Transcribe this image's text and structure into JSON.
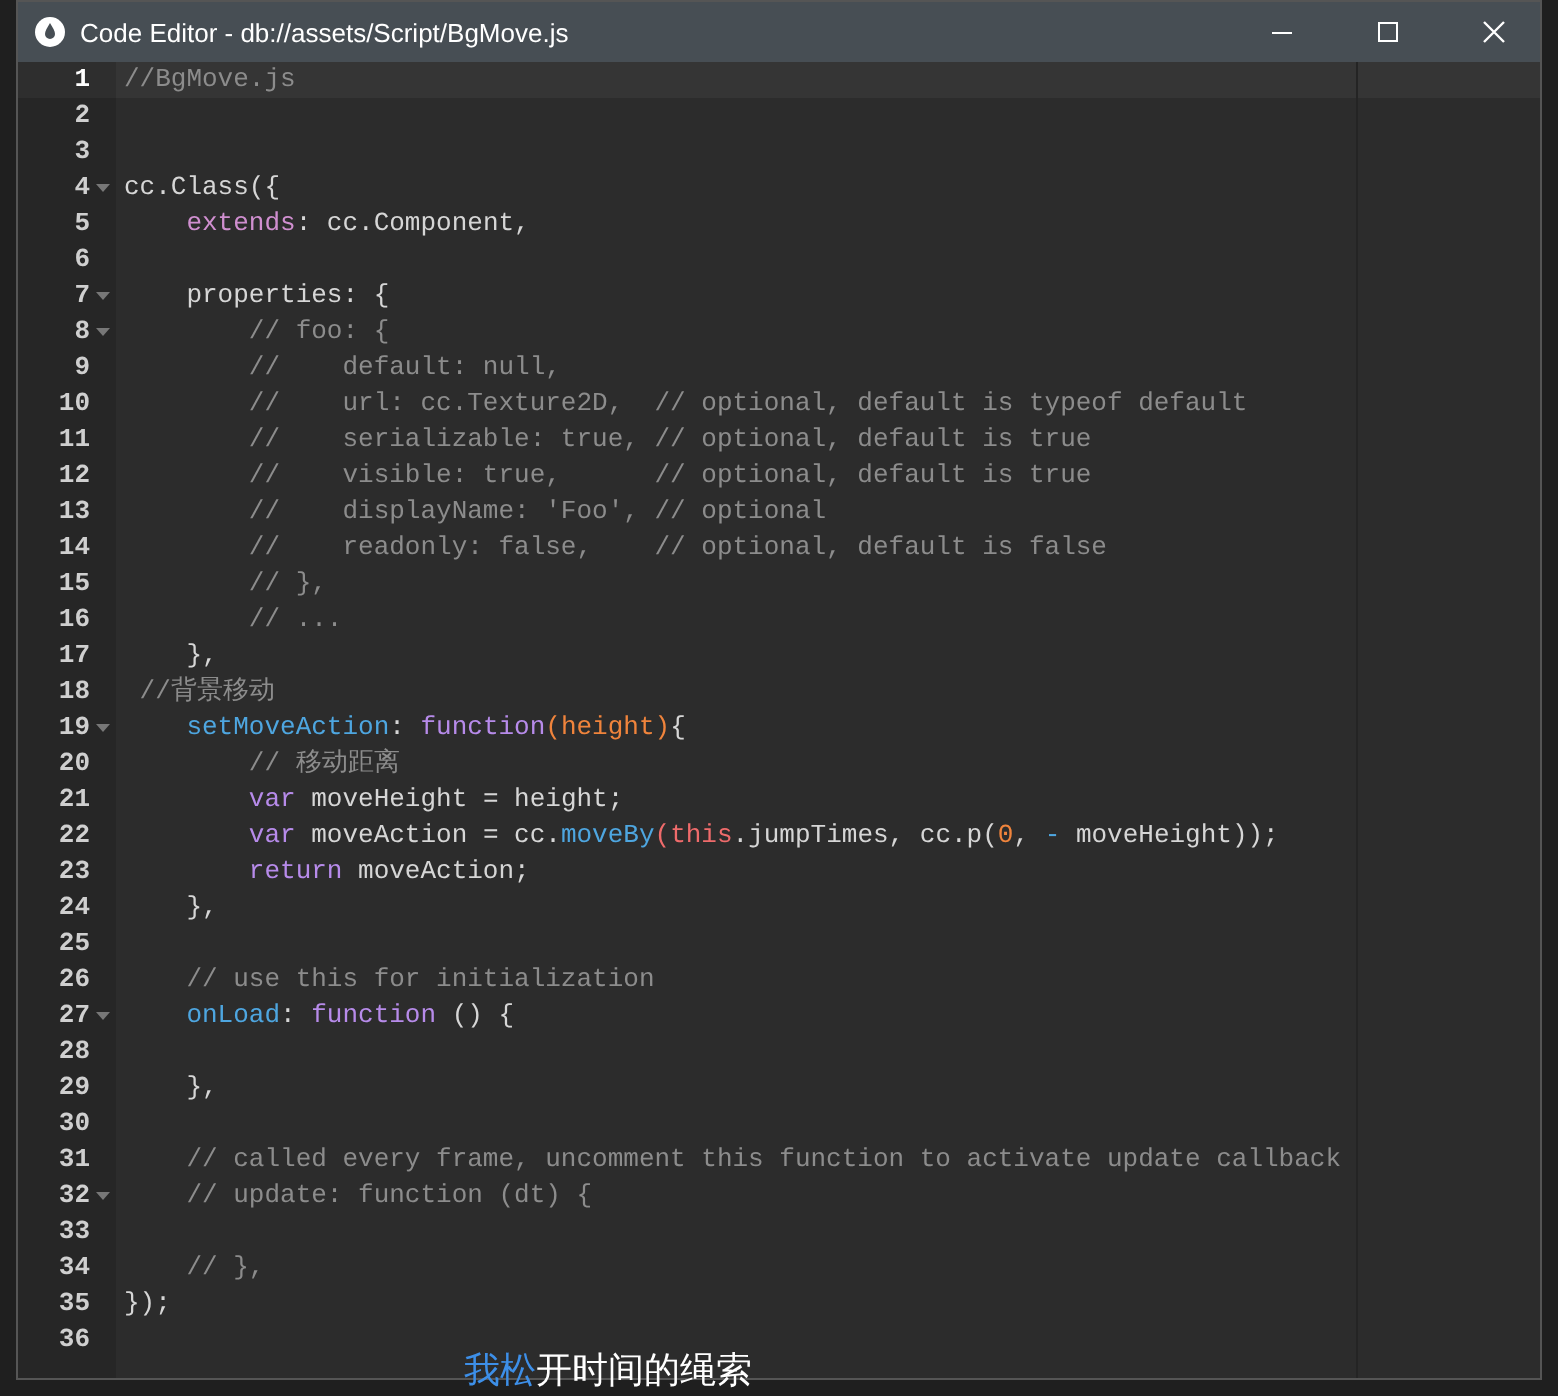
{
  "window": {
    "title": "Code Editor - db://assets/Script/BgMove.js"
  },
  "lines": [
    {
      "number": "1",
      "current": true,
      "fold": false,
      "tokens": [
        {
          "kind": "comment",
          "text": "//BgMove.js"
        }
      ]
    },
    {
      "number": "2",
      "current": false,
      "fold": false
    },
    {
      "number": "3",
      "current": false,
      "fold": false
    },
    {
      "number": "4",
      "current": false,
      "fold": true,
      "tokens": [
        {
          "kind": "plain",
          "text": "cc.Class({"
        }
      ]
    },
    {
      "number": "5",
      "current": false,
      "fold": false,
      "tokens": [
        {
          "kind": "pink",
          "text": "    extends"
        },
        {
          "kind": "plain",
          "text": ": cc.Component,"
        }
      ]
    },
    {
      "number": "6",
      "current": false,
      "fold": false
    },
    {
      "number": "7",
      "current": false,
      "fold": true,
      "tokens": [
        {
          "kind": "plain",
          "text": "    properties: {"
        }
      ]
    },
    {
      "number": "8",
      "current": false,
      "fold": true,
      "tokens": [
        {
          "kind": "comment",
          "text": "        // foo: {"
        }
      ]
    },
    {
      "number": "9",
      "current": false,
      "fold": false,
      "tokens": [
        {
          "kind": "comment",
          "text": "        //    default: null,"
        }
      ]
    },
    {
      "number": "10",
      "current": false,
      "fold": false,
      "tokens": [
        {
          "kind": "comment",
          "text": "        //    url: cc.Texture2D,  // optional, default is typeof default"
        }
      ]
    },
    {
      "number": "11",
      "current": false,
      "fold": false,
      "tokens": [
        {
          "kind": "comment",
          "text": "        //    serializable: true, // optional, default is true"
        }
      ]
    },
    {
      "number": "12",
      "current": false,
      "fold": false,
      "tokens": [
        {
          "kind": "comment",
          "text": "        //    visible: true,      // optional, default is true"
        }
      ]
    },
    {
      "number": "13",
      "current": false,
      "fold": false,
      "tokens": [
        {
          "kind": "comment",
          "text": "        //    displayName: 'Foo', // optional"
        }
      ]
    },
    {
      "number": "14",
      "current": false,
      "fold": false,
      "tokens": [
        {
          "kind": "comment",
          "text": "        //    readonly: false,    // optional, default is false"
        }
      ]
    },
    {
      "number": "15",
      "current": false,
      "fold": false,
      "tokens": [
        {
          "kind": "comment",
          "text": "        // },"
        }
      ]
    },
    {
      "number": "16",
      "current": false,
      "fold": false,
      "tokens": [
        {
          "kind": "comment",
          "text": "        // ..."
        }
      ]
    },
    {
      "number": "17",
      "current": false,
      "fold": false,
      "tokens": [
        {
          "kind": "plain",
          "text": "    },"
        }
      ]
    },
    {
      "number": "18",
      "current": false,
      "fold": false,
      "tokens": [
        {
          "kind": "comment",
          "text": " //背景移动"
        }
      ]
    },
    {
      "number": "19",
      "current": false,
      "fold": true,
      "tokens": [
        {
          "kind": "fn",
          "text": "    setMoveAction"
        },
        {
          "kind": "plain",
          "text": ": "
        },
        {
          "kind": "keyword",
          "text": "function"
        },
        {
          "kind": "param",
          "text": "(height)"
        },
        {
          "kind": "plain",
          "text": "{"
        }
      ]
    },
    {
      "number": "20",
      "current": false,
      "fold": false,
      "tokens": [
        {
          "kind": "comment",
          "text": "        // 移动距离"
        }
      ]
    },
    {
      "number": "21",
      "current": false,
      "fold": false,
      "tokens": [
        {
          "kind": "keyword",
          "text": "        var"
        },
        {
          "kind": "plain",
          "text": " moveHeight = height;"
        }
      ]
    },
    {
      "number": "22",
      "current": false,
      "fold": false,
      "tokens": [
        {
          "kind": "keyword",
          "text": "        var"
        },
        {
          "kind": "plain",
          "text": " moveAction = cc."
        },
        {
          "kind": "fn",
          "text": "moveBy"
        },
        {
          "kind": "this",
          "text": "(this"
        },
        {
          "kind": "plain",
          "text": ".jumpTimes, cc.p("
        },
        {
          "kind": "number",
          "text": "0"
        },
        {
          "kind": "plain",
          "text": ", "
        },
        {
          "kind": "fn",
          "text": "-"
        },
        {
          "kind": "plain",
          "text": " moveHeight));"
        }
      ]
    },
    {
      "number": "23",
      "current": false,
      "fold": false,
      "tokens": [
        {
          "kind": "keyword",
          "text": "        return"
        },
        {
          "kind": "plain",
          "text": " moveAction;"
        }
      ]
    },
    {
      "number": "24",
      "current": false,
      "fold": false,
      "tokens": [
        {
          "kind": "plain",
          "text": "    },"
        }
      ]
    },
    {
      "number": "25",
      "current": false,
      "fold": false
    },
    {
      "number": "26",
      "current": false,
      "fold": false,
      "tokens": [
        {
          "kind": "comment",
          "text": "    // use this for initialization"
        }
      ]
    },
    {
      "number": "27",
      "current": false,
      "fold": true,
      "tokens": [
        {
          "kind": "fn",
          "text": "    onLoad"
        },
        {
          "kind": "plain",
          "text": ": "
        },
        {
          "kind": "keyword",
          "text": "function"
        },
        {
          "kind": "plain",
          "text": " () {"
        }
      ]
    },
    {
      "number": "28",
      "current": false,
      "fold": false
    },
    {
      "number": "29",
      "current": false,
      "fold": false,
      "tokens": [
        {
          "kind": "plain",
          "text": "    },"
        }
      ]
    },
    {
      "number": "30",
      "current": false,
      "fold": false
    },
    {
      "number": "31",
      "current": false,
      "fold": false,
      "tokens": [
        {
          "kind": "comment",
          "text": "    // called every frame, uncomment this function to activate update callback"
        }
      ]
    },
    {
      "number": "32",
      "current": false,
      "fold": true,
      "tokens": [
        {
          "kind": "comment",
          "text": "    // update: function (dt) {"
        }
      ]
    },
    {
      "number": "33",
      "current": false,
      "fold": false
    },
    {
      "number": "34",
      "current": false,
      "fold": false,
      "tokens": [
        {
          "kind": "comment",
          "text": "    // },"
        }
      ]
    },
    {
      "number": "35",
      "current": false,
      "fold": false,
      "tokens": [
        {
          "kind": "plain",
          "text": "});"
        }
      ]
    },
    {
      "number": "36",
      "current": false,
      "fold": false
    }
  ],
  "subtitle": {
    "highlighted": "我松",
    "rest": "开时间的绳索"
  }
}
